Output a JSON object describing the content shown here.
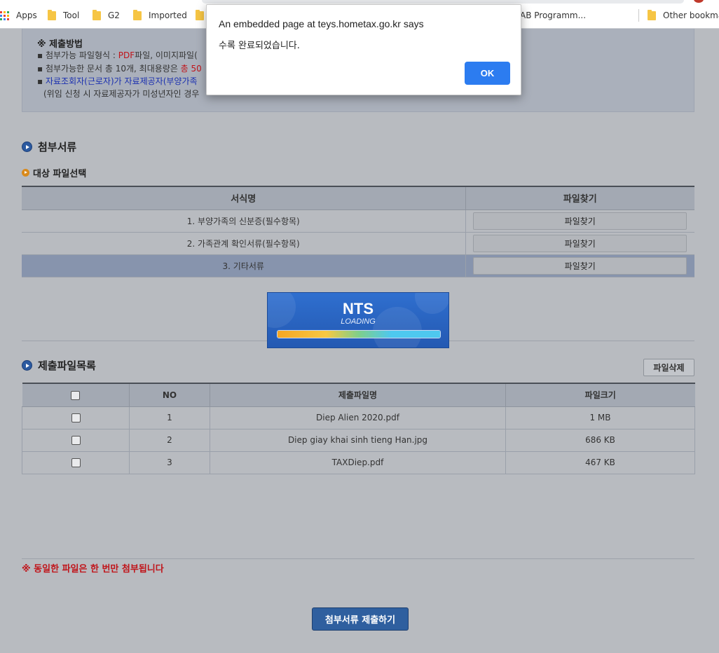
{
  "bookmarks": {
    "items": [
      "Apps",
      "Tool",
      "G2",
      "Imported",
      "AB Programm...",
      "Other bookmar"
    ]
  },
  "notice": {
    "title": "※ 제출방법",
    "line1_prefix": "첨부가능 파일형식 : ",
    "line1_red": "PDF",
    "line1_suffix": "파일, 이미지파일(",
    "line2_prefix": "첨부가능한 문서 총 10개, 최대용량은 ",
    "line2_red": "총 50",
    "line3": "자료조회자(근로자)가 자료제공자(부양가족",
    "line4": "(위임 신청 시 자료제공자가 미성년자인 경우"
  },
  "section_attach": {
    "title": "첨부서류"
  },
  "section_target": {
    "title": "대상 파일선택"
  },
  "form_table": {
    "headers": [
      "서식명",
      "파일찾기"
    ],
    "rows": [
      {
        "name": "1. 부양가족의 신분증(필수항목)",
        "button": "파일찾기"
      },
      {
        "name": "2. 가족관계 확인서류(필수항목)",
        "button": "파일찾기"
      },
      {
        "name": "3. 기타서류",
        "button": "파일찾기"
      }
    ],
    "selected_index": 2
  },
  "loader": {
    "title": "NTS",
    "subtitle": "LOADING",
    "progress": 1.0
  },
  "section_files": {
    "title": "제출파일목록",
    "delete_label": "파일삭제"
  },
  "file_table": {
    "headers": [
      "",
      "NO",
      "제출파일명",
      "파일크기"
    ],
    "rows": [
      {
        "no": "1",
        "name": "Diep Alien 2020.pdf",
        "size": "1 MB"
      },
      {
        "no": "2",
        "name": "Diep giay khai sinh tieng Han.jpg",
        "size": "686 KB"
      },
      {
        "no": "3",
        "name": "TAXDiep.pdf",
        "size": "467 KB"
      }
    ]
  },
  "warning": "※ 동일한 파일은 한 번만 첨부됩니다",
  "submit_label": "첨부서류 제출하기",
  "dialog": {
    "title": "An embedded page at teys.hometax.go.kr says",
    "message": "수록 완료되었습니다.",
    "ok_label": "OK"
  },
  "colors": {
    "accent_blue": "#2c7cf0",
    "warn_red": "#c0141a",
    "folder_yellow": "#f6c544"
  }
}
